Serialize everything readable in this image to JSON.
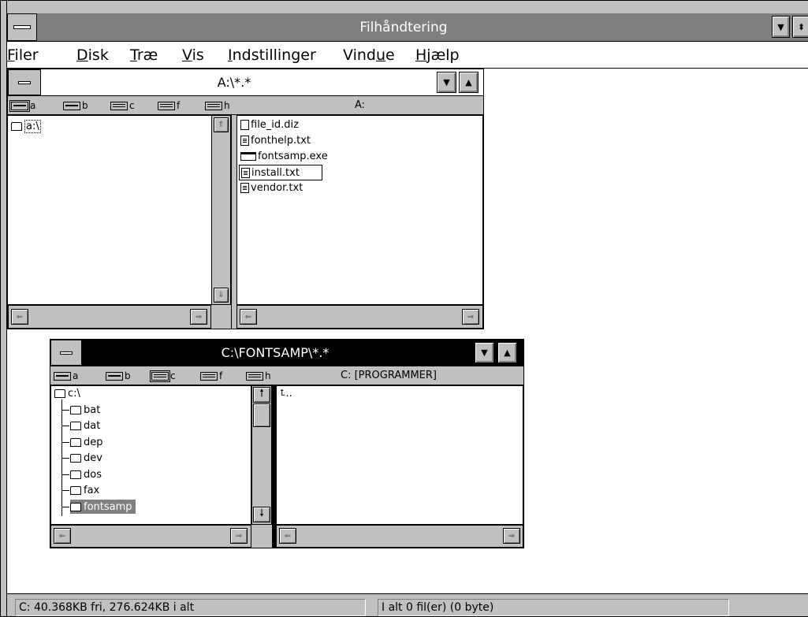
{
  "app": {
    "title": "Filhåndtering"
  },
  "menu": [
    {
      "label": "Filer",
      "u": "F",
      "rest": "iler"
    },
    {
      "label": "Disk",
      "u": "D",
      "rest": "isk"
    },
    {
      "label": "Træ",
      "u": "T",
      "rest": "ræ"
    },
    {
      "label": "Vis",
      "u": "V",
      "rest": "is"
    },
    {
      "label": "Indstillinger",
      "u": "I",
      "rest": "ndstillinger"
    },
    {
      "label": "Vindue",
      "pre": "Vind",
      "u": "u",
      "rest": "e"
    },
    {
      "label": "Hjælp",
      "u": "H",
      "rest": "jælp"
    }
  ],
  "windowA": {
    "title": "A:\\*.*",
    "drives": [
      "a",
      "b",
      "c",
      "f",
      "h"
    ],
    "volume": "A:",
    "tree": [
      {
        "label": "a:\\",
        "icon": "folder-open-icon"
      }
    ],
    "files": [
      {
        "name": "file_id.diz",
        "icon": "document-icon"
      },
      {
        "name": "fonthelp.txt",
        "icon": "text-file-icon"
      },
      {
        "name": "fontsamp.exe",
        "icon": "program-icon"
      },
      {
        "name": "install.txt",
        "icon": "text-file-icon"
      },
      {
        "name": "vendor.txt",
        "icon": "text-file-icon"
      }
    ]
  },
  "windowC": {
    "title": "C:\\FONTSAMP\\*.*",
    "drives": [
      "a",
      "b",
      "c",
      "f",
      "h"
    ],
    "volume": "C: [PROGRAMMER]",
    "tree": [
      {
        "label": "c:\\"
      },
      {
        "label": "bat"
      },
      {
        "label": "dat"
      },
      {
        "label": "dep"
      },
      {
        "label": "dev"
      },
      {
        "label": "dos"
      },
      {
        "label": "fax"
      },
      {
        "label": "fontsamp"
      }
    ],
    "files": [
      {
        "name": "..",
        "icon": "up-arrow-icon"
      }
    ]
  },
  "status": {
    "disk": "C: 40.368KB fri,  276.624KB i alt",
    "selection": "I alt 0 fil(er) (0 byte)"
  },
  "colors": {
    "active_title": "#000000",
    "inactive_title": "#ffffff",
    "frame": "#c0c0c0",
    "highlight": "#808080"
  }
}
